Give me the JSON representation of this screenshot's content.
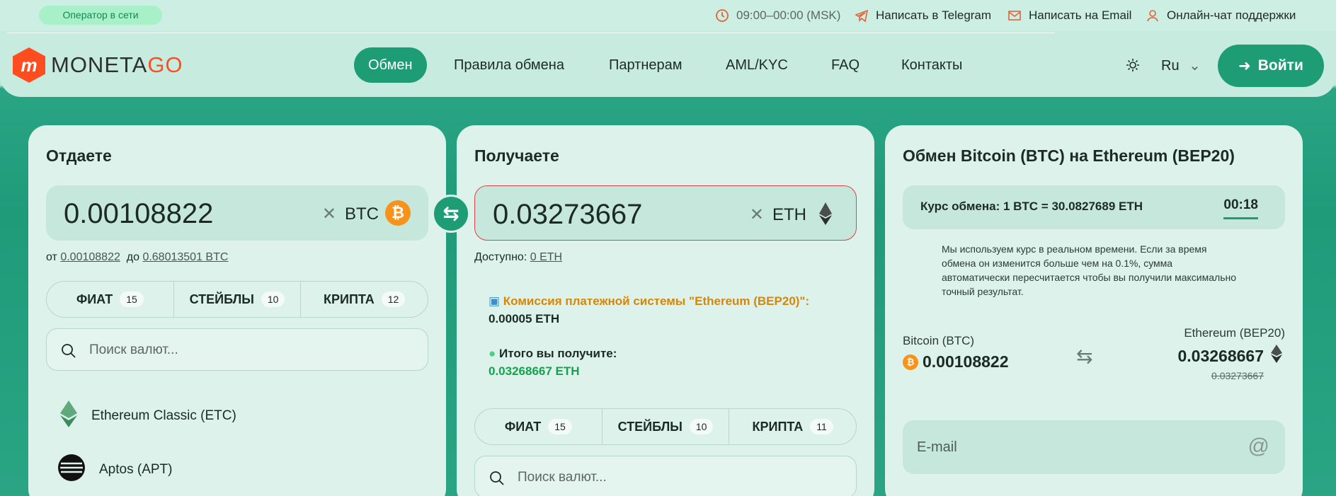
{
  "topbar": {
    "operator": "Оператор в сети",
    "hours": "09:00–00:00 (MSK)",
    "telegram": "Написать в Telegram",
    "email": "Написать на Email",
    "chat": "Онлайн-чат поддержки"
  },
  "header": {
    "logo_a": "MONETA",
    "logo_b": "GO",
    "nav": [
      "Обмен",
      "Правила обмена",
      "Партнерам",
      "AML/KYC",
      "FAQ",
      "Контакты"
    ],
    "lang": "Ru",
    "login": "Войти"
  },
  "give": {
    "title": "Отдаете",
    "amount": "0.00108822",
    "currency": "BTC",
    "range_from_label": "от",
    "range_from": "0.00108822",
    "range_to_label": "до",
    "range_to": "0.68013501 BTC",
    "tabs": [
      {
        "label": "ФИАТ",
        "count": "15"
      },
      {
        "label": "СТЕЙБЛЫ",
        "count": "10"
      },
      {
        "label": "КРИПТА",
        "count": "12"
      }
    ],
    "search_placeholder": "Поиск валют...",
    "list": [
      "Ethereum Classic (ETC)",
      "Aptos (APT)"
    ]
  },
  "get": {
    "title": "Получаете",
    "amount": "0.03273667",
    "currency": "ETH",
    "available_label": "Доступно:",
    "available": "0 ETH",
    "fee_label": "Комиссия платежной системы \"Ethereum (BEP20)\":",
    "fee_value": "0.00005 ETH",
    "total_label": "Итого вы получите:",
    "total_value": "0.03268667 ETH",
    "tabs": [
      {
        "label": "ФИАТ",
        "count": "15"
      },
      {
        "label": "СТЕЙБЛЫ",
        "count": "10"
      },
      {
        "label": "КРИПТА",
        "count": "11"
      }
    ],
    "search_placeholder": "Поиск валют..."
  },
  "summary": {
    "title": "Обмен Bitcoin (BTC) на Ethereum (BEP20)",
    "rate": "Курс обмена: 1 BTC = 30.0827689 ETH",
    "timer": "00:18",
    "note": "Мы используем курс в реальном времени. Если за время обмена он изменится больше чем на 0.1%, сумма автоматически пересчитается чтобы вы получили максимально точный результат.",
    "from_name": "Bitcoin (BTC)",
    "from_amount": "0.00108822",
    "to_name": "Ethereum (BEP20)",
    "to_amount": "0.03268667",
    "to_old": "0.03273667",
    "email_placeholder": "E-mail"
  },
  "colors": {
    "accent": "#1e9c74",
    "brand": "#ff4d1f",
    "btc": "#f7931a",
    "error": "#e0414b"
  }
}
